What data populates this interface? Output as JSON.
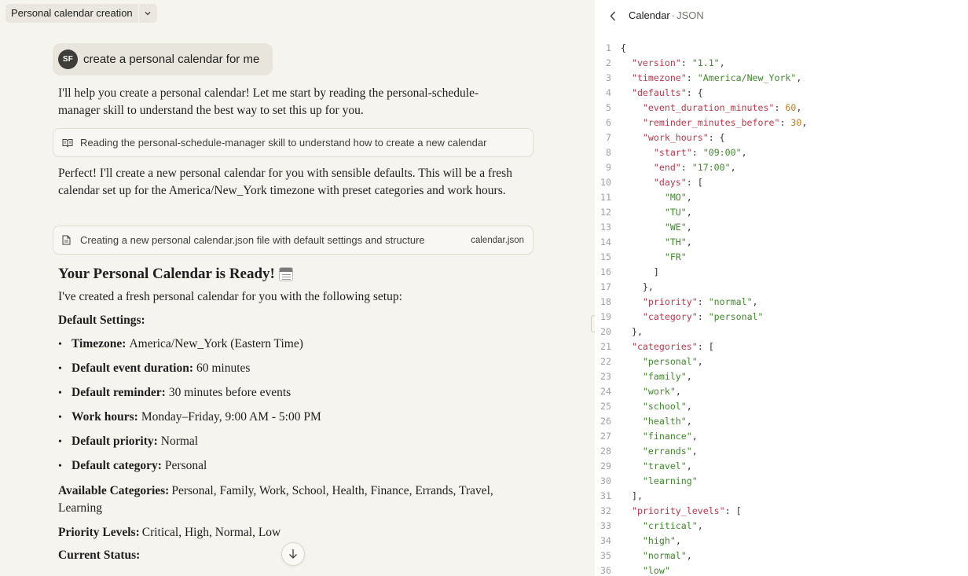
{
  "chat": {
    "title": "Personal calendar creation",
    "user_message": {
      "avatar": "SF",
      "text": "create a personal calendar for me"
    },
    "intro": "I'll help you create a personal calendar! Let me start by reading the personal-schedule-manager skill to understand the best way to set this up for you.",
    "tool_read": "Reading the personal-schedule-manager skill to understand how to create a new calendar",
    "response2": "Perfect! I'll create a new personal calendar for you with sensible defaults. This will be a fresh calendar set up for the America/New_York timezone with preset categories and work hours.",
    "tool_create": {
      "label": "Creating a new personal calendar.json file with default settings and structure",
      "file": "calendar.json"
    },
    "heading": "Your Personal Calendar is Ready!",
    "setup_intro": "I've created a fresh personal calendar for you with the following setup:",
    "default_settings_label": "Default Settings:",
    "settings": [
      {
        "label": "Timezone:",
        "value": "America/New_York (Eastern Time)"
      },
      {
        "label": "Default event duration:",
        "value": "60 minutes"
      },
      {
        "label": "Default reminder:",
        "value": "30 minutes before events"
      },
      {
        "label": "Work hours:",
        "value": "Monday–Friday, 9:00 AM - 5:00 PM"
      },
      {
        "label": "Default priority:",
        "value": "Normal"
      },
      {
        "label": "Default category:",
        "value": "Personal"
      }
    ],
    "categories": {
      "label": "Available Categories:",
      "value": "Personal, Family, Work, School, Health, Finance, Errands, Travel, Learning"
    },
    "priorities": {
      "label": "Priority Levels:",
      "value": "Critical, High, Normal, Low"
    },
    "status_label": "Current Status:"
  },
  "artifact": {
    "title": "Calendar",
    "separator": "·",
    "subtitle": "JSON",
    "lines": [
      {
        "n": "1",
        "t": [
          [
            "p",
            "{"
          ]
        ]
      },
      {
        "n": "2",
        "t": [
          [
            "p",
            "  "
          ],
          [
            "k",
            "\"version\""
          ],
          [
            "p",
            ": "
          ],
          [
            "s",
            "\"1.1\""
          ],
          [
            "p",
            ","
          ]
        ]
      },
      {
        "n": "3",
        "t": [
          [
            "p",
            "  "
          ],
          [
            "k",
            "\"timezone\""
          ],
          [
            "p",
            ": "
          ],
          [
            "s",
            "\"America/New_York\""
          ],
          [
            "p",
            ","
          ]
        ]
      },
      {
        "n": "4",
        "t": [
          [
            "p",
            "  "
          ],
          [
            "k",
            "\"defaults\""
          ],
          [
            "p",
            ": {"
          ]
        ]
      },
      {
        "n": "5",
        "t": [
          [
            "p",
            "    "
          ],
          [
            "k",
            "\"event_duration_minutes\""
          ],
          [
            "p",
            ": "
          ],
          [
            "n",
            "60"
          ],
          [
            "p",
            ","
          ]
        ]
      },
      {
        "n": "6",
        "t": [
          [
            "p",
            "    "
          ],
          [
            "k",
            "\"reminder_minutes_before\""
          ],
          [
            "p",
            ": "
          ],
          [
            "n",
            "30"
          ],
          [
            "p",
            ","
          ]
        ]
      },
      {
        "n": "7",
        "t": [
          [
            "p",
            "    "
          ],
          [
            "k",
            "\"work_hours\""
          ],
          [
            "p",
            ": {"
          ]
        ]
      },
      {
        "n": "8",
        "t": [
          [
            "p",
            "      "
          ],
          [
            "k",
            "\"start\""
          ],
          [
            "p",
            ": "
          ],
          [
            "s",
            "\"09:00\""
          ],
          [
            "p",
            ","
          ]
        ]
      },
      {
        "n": "9",
        "t": [
          [
            "p",
            "      "
          ],
          [
            "k",
            "\"end\""
          ],
          [
            "p",
            ": "
          ],
          [
            "s",
            "\"17:00\""
          ],
          [
            "p",
            ","
          ]
        ]
      },
      {
        "n": "10",
        "t": [
          [
            "p",
            "      "
          ],
          [
            "k",
            "\"days\""
          ],
          [
            "p",
            ": ["
          ]
        ]
      },
      {
        "n": "11",
        "t": [
          [
            "p",
            "        "
          ],
          [
            "s",
            "\"MO\""
          ],
          [
            "p",
            ","
          ]
        ]
      },
      {
        "n": "12",
        "t": [
          [
            "p",
            "        "
          ],
          [
            "s",
            "\"TU\""
          ],
          [
            "p",
            ","
          ]
        ]
      },
      {
        "n": "13",
        "t": [
          [
            "p",
            "        "
          ],
          [
            "s",
            "\"WE\""
          ],
          [
            "p",
            ","
          ]
        ]
      },
      {
        "n": "14",
        "t": [
          [
            "p",
            "        "
          ],
          [
            "s",
            "\"TH\""
          ],
          [
            "p",
            ","
          ]
        ]
      },
      {
        "n": "15",
        "t": [
          [
            "p",
            "        "
          ],
          [
            "s",
            "\"FR\""
          ]
        ]
      },
      {
        "n": "16",
        "t": [
          [
            "p",
            "      ]"
          ]
        ]
      },
      {
        "n": "17",
        "t": [
          [
            "p",
            "    },"
          ]
        ]
      },
      {
        "n": "18",
        "t": [
          [
            "p",
            "    "
          ],
          [
            "k",
            "\"priority\""
          ],
          [
            "p",
            ": "
          ],
          [
            "s",
            "\"normal\""
          ],
          [
            "p",
            ","
          ]
        ]
      },
      {
        "n": "19",
        "t": [
          [
            "p",
            "    "
          ],
          [
            "k",
            "\"category\""
          ],
          [
            "p",
            ": "
          ],
          [
            "s",
            "\"personal\""
          ]
        ]
      },
      {
        "n": "20",
        "t": [
          [
            "p",
            "  },"
          ]
        ]
      },
      {
        "n": "21",
        "t": [
          [
            "p",
            "  "
          ],
          [
            "k",
            "\"categories\""
          ],
          [
            "p",
            ": ["
          ]
        ]
      },
      {
        "n": "22",
        "t": [
          [
            "p",
            "    "
          ],
          [
            "s",
            "\"personal\""
          ],
          [
            "p",
            ","
          ]
        ]
      },
      {
        "n": "23",
        "t": [
          [
            "p",
            "    "
          ],
          [
            "s",
            "\"family\""
          ],
          [
            "p",
            ","
          ]
        ]
      },
      {
        "n": "24",
        "t": [
          [
            "p",
            "    "
          ],
          [
            "s",
            "\"work\""
          ],
          [
            "p",
            ","
          ]
        ]
      },
      {
        "n": "25",
        "t": [
          [
            "p",
            "    "
          ],
          [
            "s",
            "\"school\""
          ],
          [
            "p",
            ","
          ]
        ]
      },
      {
        "n": "26",
        "t": [
          [
            "p",
            "    "
          ],
          [
            "s",
            "\"health\""
          ],
          [
            "p",
            ","
          ]
        ]
      },
      {
        "n": "27",
        "t": [
          [
            "p",
            "    "
          ],
          [
            "s",
            "\"finance\""
          ],
          [
            "p",
            ","
          ]
        ]
      },
      {
        "n": "28",
        "t": [
          [
            "p",
            "    "
          ],
          [
            "s",
            "\"errands\""
          ],
          [
            "p",
            ","
          ]
        ]
      },
      {
        "n": "29",
        "t": [
          [
            "p",
            "    "
          ],
          [
            "s",
            "\"travel\""
          ],
          [
            "p",
            ","
          ]
        ]
      },
      {
        "n": "30",
        "t": [
          [
            "p",
            "    "
          ],
          [
            "s",
            "\"learning\""
          ]
        ]
      },
      {
        "n": "31",
        "t": [
          [
            "p",
            "  ],"
          ]
        ]
      },
      {
        "n": "32",
        "t": [
          [
            "p",
            "  "
          ],
          [
            "k",
            "\"priority_levels\""
          ],
          [
            "p",
            ": ["
          ]
        ]
      },
      {
        "n": "33",
        "t": [
          [
            "p",
            "    "
          ],
          [
            "s",
            "\"critical\""
          ],
          [
            "p",
            ","
          ]
        ]
      },
      {
        "n": "34",
        "t": [
          [
            "p",
            "    "
          ],
          [
            "s",
            "\"high\""
          ],
          [
            "p",
            ","
          ]
        ]
      },
      {
        "n": "35",
        "t": [
          [
            "p",
            "    "
          ],
          [
            "s",
            "\"normal\""
          ],
          [
            "p",
            ","
          ]
        ]
      },
      {
        "n": "36",
        "t": [
          [
            "p",
            "    "
          ],
          [
            "s",
            "\"low\""
          ]
        ]
      }
    ]
  }
}
